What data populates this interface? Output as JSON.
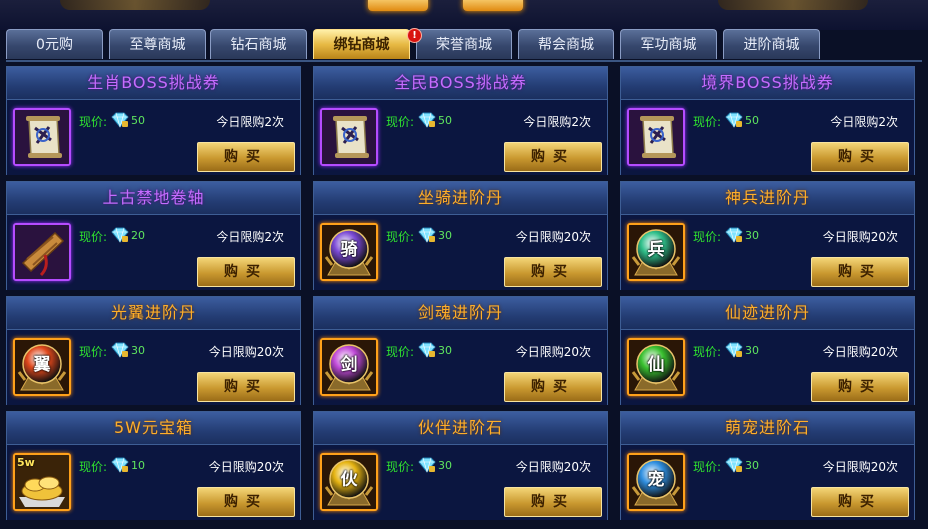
{
  "tabs": [
    {
      "label": "0元购",
      "active": false,
      "alert": ""
    },
    {
      "label": "至尊商城",
      "active": false,
      "alert": ""
    },
    {
      "label": "钻石商城",
      "active": false,
      "alert": ""
    },
    {
      "label": "绑钻商城",
      "active": true,
      "alert": ""
    },
    {
      "label": "荣誉商城",
      "active": false,
      "alert": "!"
    },
    {
      "label": "帮会商城",
      "active": false,
      "alert": ""
    },
    {
      "label": "军功商城",
      "active": false,
      "alert": ""
    },
    {
      "label": "进阶商城",
      "active": false,
      "alert": ""
    }
  ],
  "labels": {
    "price": "现价:",
    "buy": "购买"
  },
  "colors": {
    "title_purple": "#c56cff",
    "title_orange": "#ffae29",
    "price_green": "#2fe22f",
    "active_tab_gold": "#e7b944"
  },
  "items": [
    {
      "name": "生肖BOSS挑战券",
      "rarity": "purple",
      "icon": "scroll-ticket-icon",
      "glyph": "",
      "price": "50",
      "limit": "今日限购2次"
    },
    {
      "name": "全民BOSS挑战券",
      "rarity": "purple",
      "icon": "scroll-ticket-icon",
      "glyph": "",
      "price": "50",
      "limit": "今日限购2次"
    },
    {
      "name": "境界BOSS挑战券",
      "rarity": "purple",
      "icon": "scroll-ticket-icon",
      "glyph": "",
      "price": "50",
      "limit": "今日限购2次"
    },
    {
      "name": "上古禁地卷轴",
      "rarity": "purple",
      "icon": "rolled-scroll-icon",
      "glyph": "",
      "price": "20",
      "limit": "今日限购2次"
    },
    {
      "name": "坐骑进阶丹",
      "rarity": "orange",
      "icon": "advance-pill-icon",
      "glyph": "骑",
      "orb": "#7b4ad6",
      "price": "30",
      "limit": "今日限购20次"
    },
    {
      "name": "神兵进阶丹",
      "rarity": "orange",
      "icon": "advance-pill-icon",
      "glyph": "兵",
      "orb": "#2fbf8a",
      "price": "30",
      "limit": "今日限购20次"
    },
    {
      "name": "光翼进阶丹",
      "rarity": "orange",
      "icon": "advance-pill-icon",
      "glyph": "翼",
      "orb": "#e0481c",
      "price": "30",
      "limit": "今日限购20次"
    },
    {
      "name": "剑魂进阶丹",
      "rarity": "orange",
      "icon": "advance-pill-icon",
      "glyph": "剑",
      "orb": "#c04ad8",
      "price": "30",
      "limit": "今日限购20次"
    },
    {
      "name": "仙迹进阶丹",
      "rarity": "orange",
      "icon": "advance-pill-icon",
      "glyph": "仙",
      "orb": "#39c02f",
      "price": "30",
      "limit": "今日限购20次"
    },
    {
      "name": "5W元宝箱",
      "rarity": "orange",
      "icon": "gold-ingot-chest-icon",
      "glyph": "5w",
      "price": "10",
      "limit": "今日限购20次"
    },
    {
      "name": "伙伴进阶石",
      "rarity": "orange",
      "icon": "advance-pill-icon",
      "glyph": "伙",
      "orb": "#e6b412",
      "price": "30",
      "limit": "今日限购20次"
    },
    {
      "name": "萌宠进阶石",
      "rarity": "orange",
      "icon": "advance-pill-icon",
      "glyph": "宠",
      "orb": "#2f8fe0",
      "price": "30",
      "limit": "今日限购20次"
    }
  ]
}
